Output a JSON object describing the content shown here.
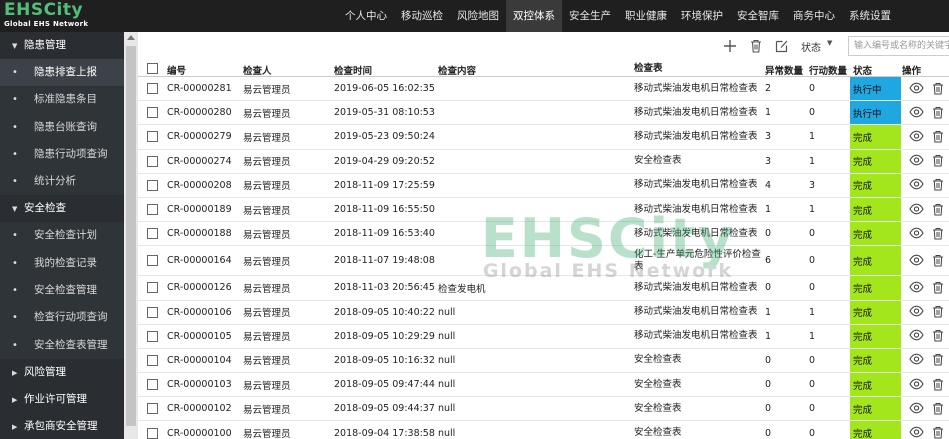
{
  "logo": {
    "main": "EHSCity",
    "sub": "Global EHS Network"
  },
  "topnav": [
    {
      "label": "个人中心"
    },
    {
      "label": "移动巡检"
    },
    {
      "label": "风险地图"
    },
    {
      "label": "双控体系"
    },
    {
      "label": "安全生产"
    },
    {
      "label": "职业健康"
    },
    {
      "label": "环境保护"
    },
    {
      "label": "安全智库"
    },
    {
      "label": "商务中心"
    },
    {
      "label": "系统设置"
    }
  ],
  "sidebar": {
    "group1": {
      "label": "隐患管理",
      "items": [
        "隐患排查上报",
        "标准隐患条目",
        "隐患台账查询",
        "隐患行动项查询",
        "统计分析"
      ]
    },
    "group2": {
      "label": "安全检查",
      "items": [
        "安全检查计划",
        "我的检查记录",
        "安全检查管理",
        "检查行动项查询",
        "安全检查表管理"
      ]
    },
    "group3": {
      "label": "风险管理"
    },
    "group4": {
      "label": "作业许可管理"
    },
    "group5": {
      "label": "承包商安全管理"
    }
  },
  "toolbar": {
    "status_label": "状态",
    "search_placeholder": "输入编号或名称的关键字"
  },
  "table": {
    "headers": {
      "no": "编号",
      "user": "检查人",
      "time": "检查时间",
      "content": "检查内容",
      "form": "检查表",
      "err": "异常数量",
      "act": "行动数量",
      "status": "状态",
      "ops": "操作"
    },
    "rows": [
      {
        "no": "CR-00000281",
        "user": "易云管理员",
        "time": "2019-06-05 16:02:35",
        "content": "",
        "form": "移动式柴油发电机日常检查表",
        "err": "2",
        "act": "0",
        "status": "执行中"
      },
      {
        "no": "CR-00000280",
        "user": "易云管理员",
        "time": "2019-05-31 08:10:53",
        "content": "",
        "form": "移动式柴油发电机日常检查表",
        "err": "1",
        "act": "0",
        "status": "执行中"
      },
      {
        "no": "CR-00000279",
        "user": "易云管理员",
        "time": "2019-05-23 09:50:24",
        "content": "",
        "form": "移动式柴油发电机日常检查表",
        "err": "3",
        "act": "1",
        "status": "完成"
      },
      {
        "no": "CR-00000274",
        "user": "易云管理员",
        "time": "2019-04-29 09:20:52",
        "content": "",
        "form": "安全检查表",
        "err": "3",
        "act": "1",
        "status": "完成"
      },
      {
        "no": "CR-00000208",
        "user": "易云管理员",
        "time": "2018-11-09 17:25:59",
        "content": "",
        "form": "移动式柴油发电机日常检查表",
        "err": "4",
        "act": "3",
        "status": "完成"
      },
      {
        "no": "CR-00000189",
        "user": "易云管理员",
        "time": "2018-11-09 16:55:50",
        "content": "",
        "form": "移动式柴油发电机日常检查表",
        "err": "1",
        "act": "1",
        "status": "完成"
      },
      {
        "no": "CR-00000188",
        "user": "易云管理员",
        "time": "2018-11-09 16:53:40",
        "content": "",
        "form": "移动式柴油发电机日常检查表",
        "err": "0",
        "act": "0",
        "status": "完成"
      },
      {
        "no": "CR-00000164",
        "user": "易云管理员",
        "time": "2018-11-07 19:48:08",
        "content": "",
        "form": "化工-生产单元危险性评价检查表",
        "err": "6",
        "act": "0",
        "status": "完成"
      },
      {
        "no": "CR-00000126",
        "user": "易云管理员",
        "time": "2018-11-03 20:56:45",
        "content": "检查发电机",
        "form": "移动式柴油发电机日常检查表",
        "err": "0",
        "act": "0",
        "status": "完成"
      },
      {
        "no": "CR-00000106",
        "user": "易云管理员",
        "time": "2018-09-05 10:40:22",
        "content": "null",
        "form": "移动式柴油发电机日常检查表",
        "err": "1",
        "act": "1",
        "status": "完成"
      },
      {
        "no": "CR-00000105",
        "user": "易云管理员",
        "time": "2018-09-05 10:29:29",
        "content": "null",
        "form": "移动式柴油发电机日常检查表",
        "err": "1",
        "act": "1",
        "status": "完成"
      },
      {
        "no": "CR-00000104",
        "user": "易云管理员",
        "time": "2018-09-05 10:16:32",
        "content": "null",
        "form": "安全检查表",
        "err": "0",
        "act": "0",
        "status": "完成"
      },
      {
        "no": "CR-00000103",
        "user": "易云管理员",
        "time": "2018-09-05 09:47:44",
        "content": "null",
        "form": "安全检查表",
        "err": "0",
        "act": "0",
        "status": "完成"
      },
      {
        "no": "CR-00000102",
        "user": "易云管理员",
        "time": "2018-09-05 09:44:37",
        "content": "null",
        "form": "安全检查表",
        "err": "0",
        "act": "0",
        "status": "完成"
      },
      {
        "no": "CR-00000100",
        "user": "易云管理员",
        "time": "2018-09-04 17:38:58",
        "content": "null",
        "form": "安全检查表",
        "err": "0",
        "act": "0",
        "status": "完成"
      }
    ]
  },
  "colors": {
    "topbar": "#1f1f1f",
    "sidebar": "#2f3439",
    "status_running": "#1ea7e0",
    "status_done": "#a4e61c",
    "logo_green": "#4fbf7a"
  },
  "watermark": {
    "main": "EHSCity",
    "sub": "Global EHS Network"
  }
}
